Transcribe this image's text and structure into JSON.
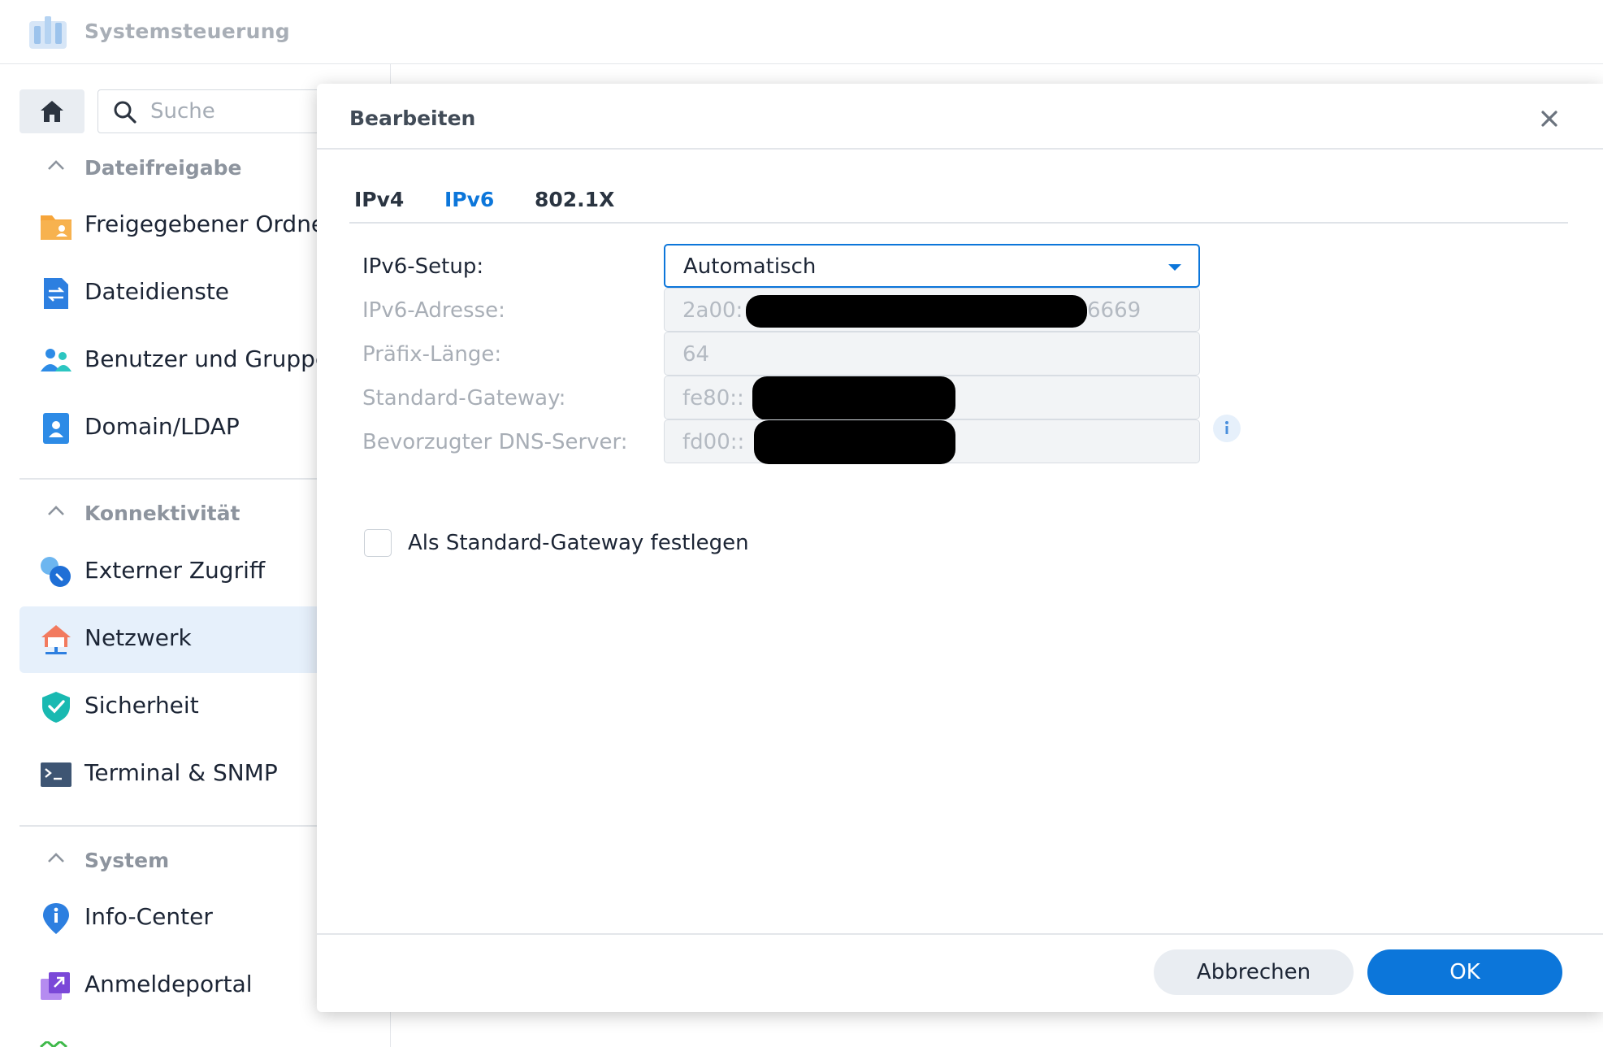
{
  "app": {
    "title": "Systemsteuerung"
  },
  "sidebar": {
    "search_placeholder": "Suche",
    "sections": [
      {
        "title": "Dateifreigabe",
        "items": [
          {
            "label": "Freigegebener Ordner",
            "icon": "shared-folder-icon"
          },
          {
            "label": "Dateidienste",
            "icon": "file-services-icon"
          },
          {
            "label": "Benutzer und Gruppe",
            "icon": "users-groups-icon"
          },
          {
            "label": "Domain/LDAP",
            "icon": "domain-ldap-icon"
          }
        ]
      },
      {
        "title": "Konnektivität",
        "items": [
          {
            "label": "Externer Zugriff",
            "icon": "external-access-icon"
          },
          {
            "label": "Netzwerk",
            "icon": "network-icon",
            "active": true
          },
          {
            "label": "Sicherheit",
            "icon": "security-shield-icon"
          },
          {
            "label": "Terminal & SNMP",
            "icon": "terminal-icon"
          }
        ]
      },
      {
        "title": "System",
        "items": [
          {
            "label": "Info-Center",
            "icon": "info-center-icon"
          },
          {
            "label": "Anmeldeportal",
            "icon": "login-portal-icon"
          }
        ]
      }
    ]
  },
  "dialog": {
    "title": "Bearbeiten",
    "tabs": [
      {
        "label": "IPv4",
        "active": false
      },
      {
        "label": "IPv6",
        "active": true
      },
      {
        "label": "802.1X",
        "active": false
      }
    ],
    "fields": {
      "setup": {
        "label": "IPv6-Setup:",
        "value": "Automatisch"
      },
      "address": {
        "label": "IPv6-Adresse:",
        "value_prefix": "2a00:",
        "value_suffix": "6669"
      },
      "prefix": {
        "label": "Präfix-Länge:",
        "value": "64"
      },
      "gateway": {
        "label": "Standard-Gateway:",
        "value_prefix": "fe80::"
      },
      "dns": {
        "label": "Bevorzugter DNS-Server:",
        "value_prefix": "fd00::"
      }
    },
    "checkbox": {
      "label": "Als Standard-Gateway festlegen",
      "checked": false
    },
    "buttons": {
      "cancel": "Abbrechen",
      "ok": "OK"
    }
  },
  "colors": {
    "accent": "#0c76da",
    "active_bg": "#e6f0fb",
    "muted_text": "#a8aeb6"
  }
}
